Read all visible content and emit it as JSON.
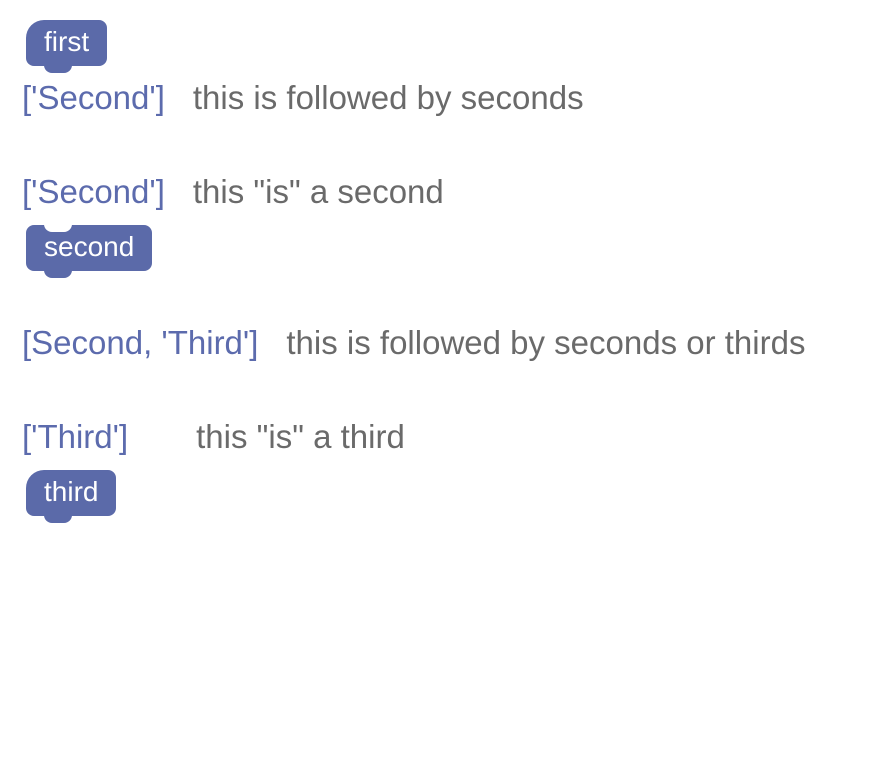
{
  "colors": {
    "block_fill": "#5b6aa9",
    "block_text": "#ffffff",
    "tag_text": "#5c6bad",
    "desc_text": "#6a6a6a"
  },
  "entries": [
    {
      "block_label": "first",
      "block_style": "hat",
      "block_position": "above",
      "tags": "['Second']",
      "description": "this is followed by seconds"
    },
    {
      "block_label": "second",
      "block_style": "stack",
      "block_position": "below",
      "tags": "['Second']",
      "description": "this \"is\" a second"
    },
    {
      "block_label": null,
      "block_style": null,
      "block_position": null,
      "tags": "[Second, 'Third']",
      "description": "this is followed by seconds or thirds"
    },
    {
      "block_label": "third",
      "block_style": "hat",
      "block_position": "below",
      "tags": "['Third']",
      "description": "this \"is\" a third"
    }
  ]
}
